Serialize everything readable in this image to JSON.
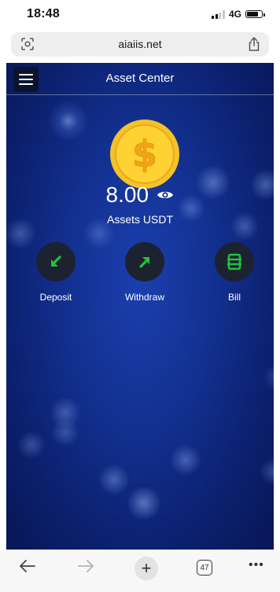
{
  "status_bar": {
    "time": "18:48",
    "network": "4G"
  },
  "browser": {
    "url": "aiaiis.net",
    "tab_count": "47"
  },
  "app": {
    "header_title": "Asset Center",
    "balance": "8.00",
    "assets_label": "Assets USDT",
    "actions": [
      {
        "label": "Deposit",
        "icon": "arrow-down-left-icon"
      },
      {
        "label": "Withdraw",
        "icon": "arrow-up-right-icon"
      },
      {
        "label": "Bill",
        "icon": "bill-icon"
      }
    ]
  },
  "colors": {
    "background": "#12308f",
    "action_icon": "#1ec43a",
    "coin": "#f5c22a"
  }
}
